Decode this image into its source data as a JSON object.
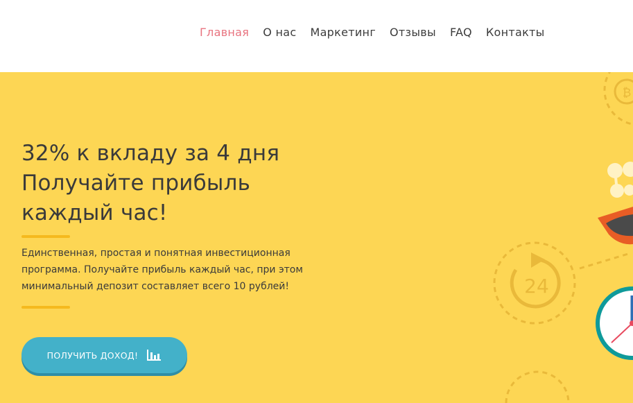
{
  "nav": {
    "items": [
      {
        "label": "Главная",
        "active": true
      },
      {
        "label": "О нас",
        "active": false
      },
      {
        "label": "Маркетинг",
        "active": false
      },
      {
        "label": "Отзывы",
        "active": false
      },
      {
        "label": "FAQ",
        "active": false
      },
      {
        "label": "Контакты",
        "active": false
      }
    ],
    "active_color": "#e8737f"
  },
  "hero": {
    "headline_lines": [
      "32% к вкладу за 4 дня",
      "Получайте прибыль",
      "каждый час!"
    ],
    "description_lines": [
      "Единственная, простая и понятная инвестиционная",
      "программа. Получайте прибыль каждый час, при этом",
      "минимальный депозит составляет всего 10 рублей!"
    ],
    "cta_label": "ПОЛУЧИТЬ ДОХОД!",
    "cta_icon": "bar-chart-icon",
    "badge_text": "24",
    "coin_symbol": "₿",
    "background_color": "#fdd654",
    "accent_color": "#f5b91e",
    "button_color": "#43b1c9"
  }
}
